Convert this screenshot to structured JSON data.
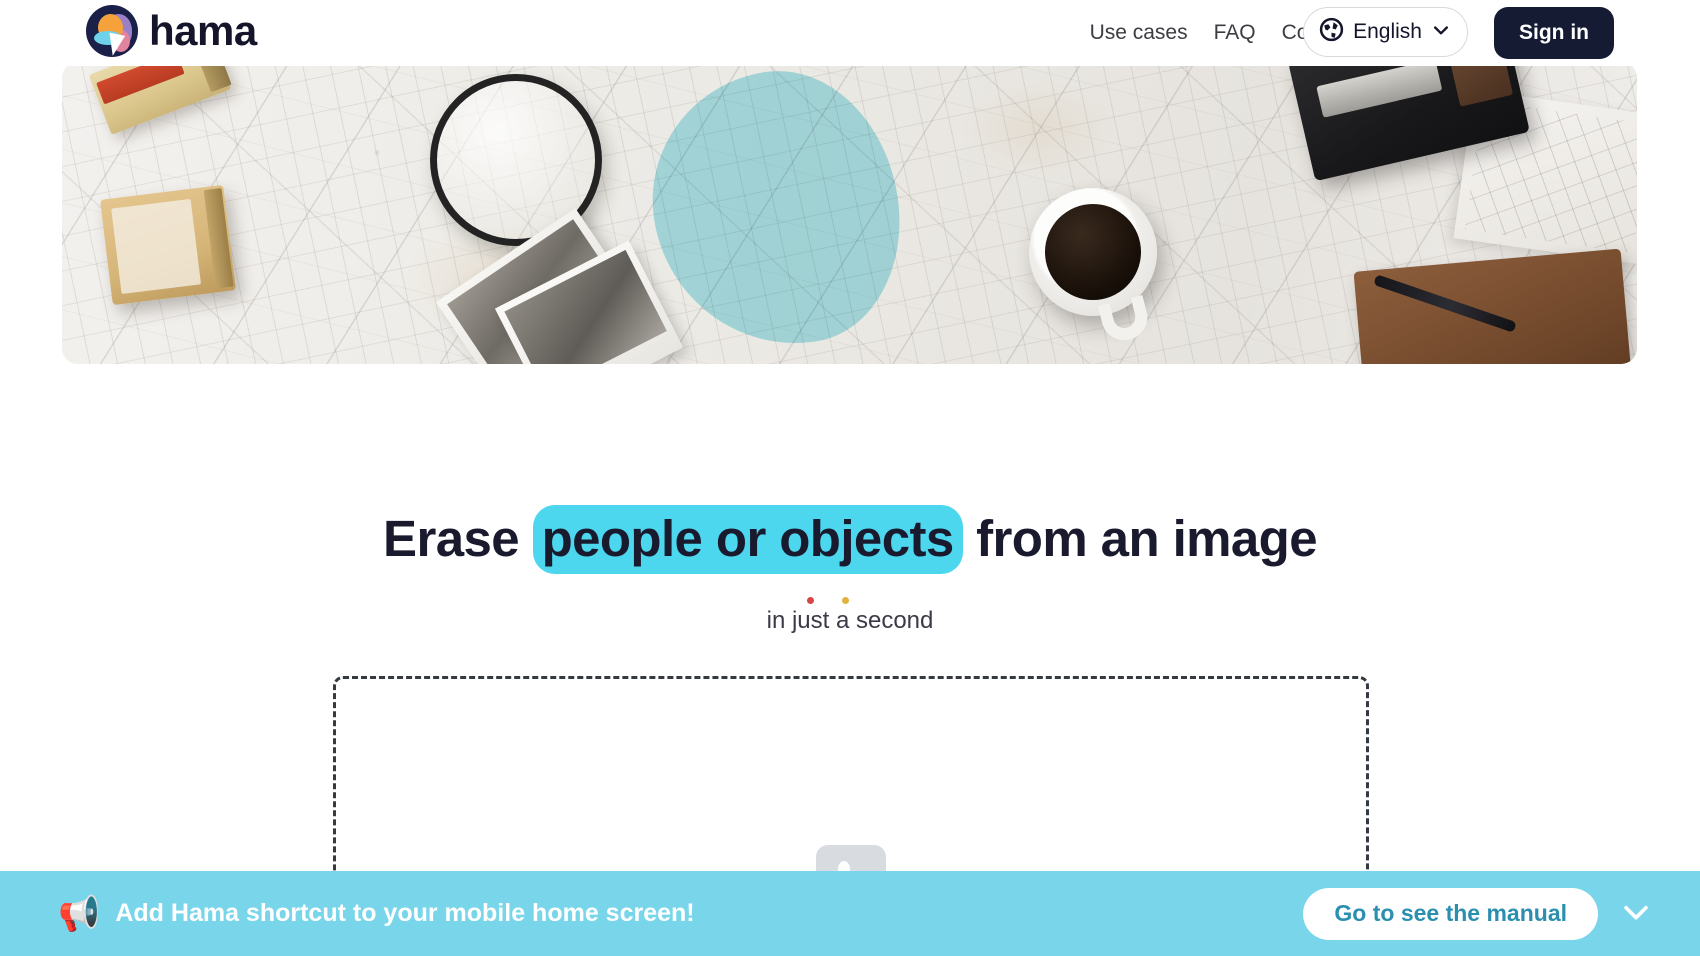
{
  "header": {
    "brand_name": "hama",
    "brand_logo_icon": "hama-logo-icon",
    "nav": [
      {
        "label": "Use cases"
      },
      {
        "label": "FAQ"
      },
      {
        "label": "Contact"
      }
    ],
    "language": {
      "label": "English",
      "globe_icon": "globe-icon",
      "chevron_icon": "chevron-down-icon"
    },
    "signin_label": "Sign in"
  },
  "hero": {
    "image_alt": "Vintage road map with film boxes, magnifying glass, photographs, coffee cup, camera and notebook",
    "mask_color": "#78d6e4"
  },
  "main": {
    "headline_before": "Erase ",
    "headline_highlight": "people or objects",
    "headline_after": " from an image",
    "subhead": "in just a second",
    "highlight_color": "#4cd7ef",
    "dropzone": {
      "placeholder_icon": "image-placeholder-icon"
    }
  },
  "banner": {
    "megaphone_icon": "📢",
    "message": "Add Hama shortcut to your mobile home screen!",
    "cta_label": "Go to see the manual",
    "close_icon": "chevron-down-icon",
    "background_color": "#79d6ea",
    "cta_text_color": "#2b8fb0"
  }
}
